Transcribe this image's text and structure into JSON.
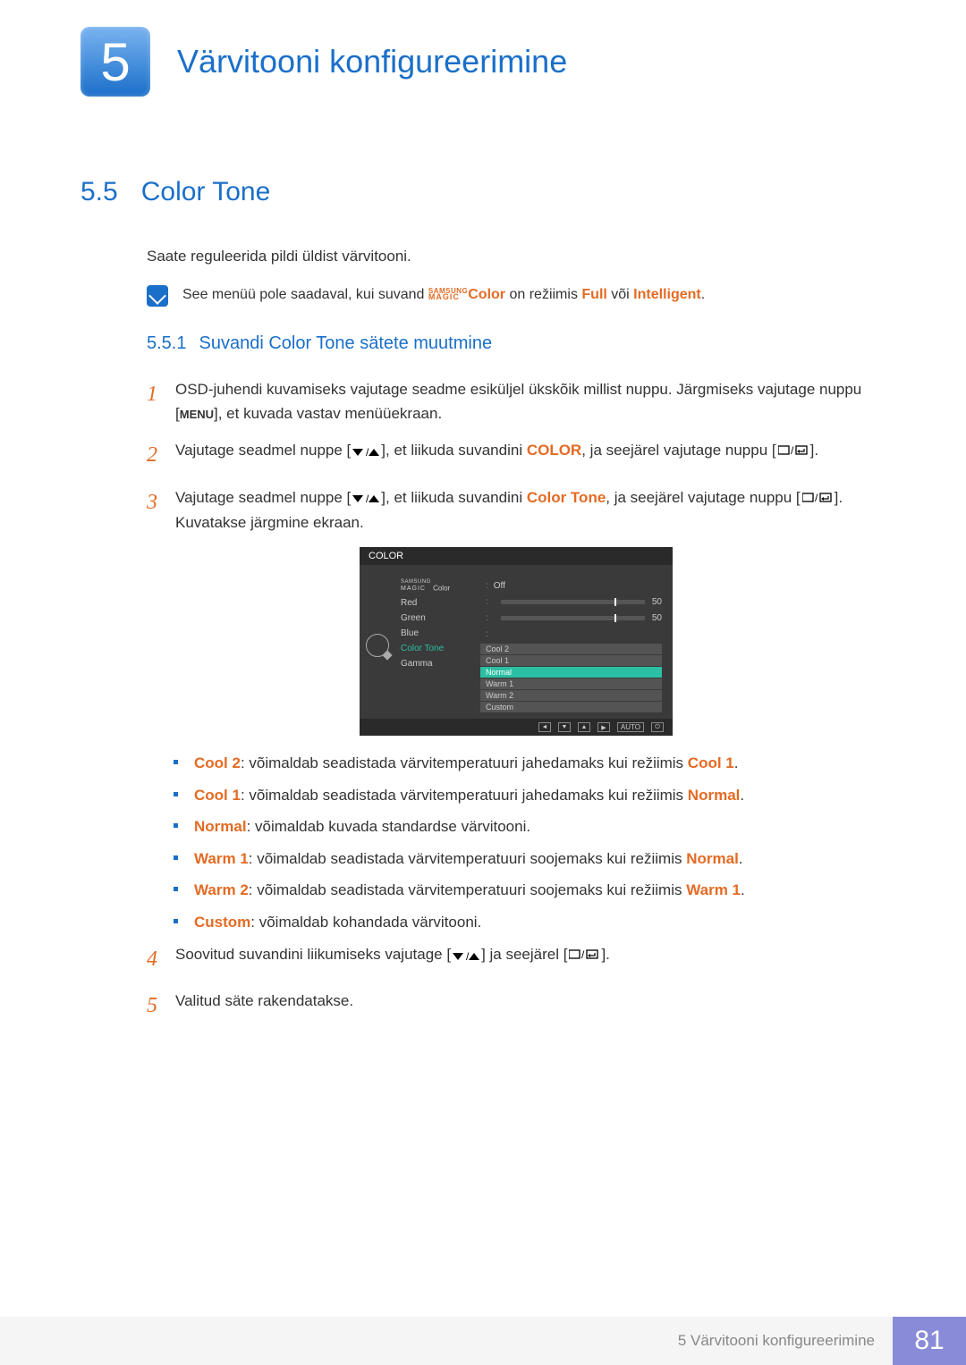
{
  "chapter": {
    "number": "5",
    "title": "Värvitooni konfigureerimine"
  },
  "section": {
    "number": "5.5",
    "title": "Color Tone"
  },
  "intro": "Saate reguleerida pildi üldist värvitooni.",
  "note": {
    "prefix": "See menüü pole saadaval, kui suvand ",
    "magic_top": "SAMSUNG",
    "magic_bottom": "MAGIC",
    "color_word": "Color",
    "mid": " on režiimis ",
    "full": "Full",
    "or": " või ",
    "intelligent": "Intelligent",
    "suffix": "."
  },
  "subsection": {
    "number": "5.5.1",
    "title": "Suvandi Color Tone sätete muutmine"
  },
  "steps": {
    "s1": {
      "num": "1",
      "a": "OSD-juhendi kuvamiseks vajutage seadme esiküljel ükskõik millist nuppu. Järgmiseks vajutage nuppu [",
      "menu": "MENU",
      "b": "], et kuvada vastav menüüekraan."
    },
    "s2": {
      "num": "2",
      "a": "Vajutage seadmel nuppe [",
      "b": "], et liikuda suvandini ",
      "target": "COLOR",
      "c": ", ja seejärel vajutage nuppu [",
      "d": "]."
    },
    "s3": {
      "num": "3",
      "a": "Vajutage seadmel nuppe [",
      "b": "], et liikuda suvandini ",
      "target": "Color Tone",
      "c": ", ja seejärel vajutage nuppu [",
      "d": "]. Kuvatakse järgmine ekraan."
    },
    "s4": {
      "num": "4",
      "a": "Soovitud suvandini liikumiseks vajutage [",
      "b": "] ja seejärel [",
      "c": "]."
    },
    "s5": {
      "num": "5",
      "a": "Valitud säte rakendatakse."
    }
  },
  "osd": {
    "title": "COLOR",
    "labels": {
      "magic_top": "SAMSUNG",
      "magic_bottom": "MAGIC",
      "magic_color": "Color",
      "red": "Red",
      "green": "Green",
      "blue": "Blue",
      "color_tone": "Color Tone",
      "gamma": "Gamma"
    },
    "values": {
      "magic_color": "Off",
      "red": "50",
      "green": "50",
      "tones": [
        "Cool 2",
        "Cool 1",
        "Normal",
        "Warm 1",
        "Warm 2",
        "Custom"
      ]
    },
    "footer_auto": "AUTO"
  },
  "bullets": {
    "b1": {
      "lead": "Cool 2",
      "text": ": võimaldab seadistada värvitemperatuuri jahedamaks kui režiimis ",
      "ref": "Cool 1",
      "suffix": "."
    },
    "b2": {
      "lead": "Cool 1",
      "text": ": võimaldab seadistada värvitemperatuuri jahedamaks kui režiimis ",
      "ref": "Normal",
      "suffix": "."
    },
    "b3": {
      "lead": "Normal",
      "text": ": võimaldab kuvada standardse värvitooni.",
      "ref": "",
      "suffix": ""
    },
    "b4": {
      "lead": "Warm 1",
      "text": ": võimaldab seadistada värvitemperatuuri soojemaks kui režiimis ",
      "ref": "Normal",
      "suffix": "."
    },
    "b5": {
      "lead": "Warm 2",
      "text": ": võimaldab seadistada värvitemperatuuri soojemaks kui režiimis ",
      "ref": "Warm 1",
      "suffix": "."
    },
    "b6": {
      "lead": "Custom",
      "text": ": võimaldab kohandada värvitooni.",
      "ref": "",
      "suffix": ""
    }
  },
  "footer": {
    "text": "5 Värvitooni konfigureerimine",
    "page": "81"
  }
}
